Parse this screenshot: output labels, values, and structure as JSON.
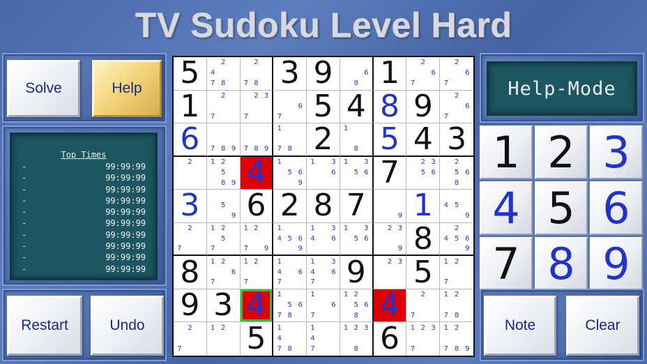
{
  "title": "TV Sudoku Level Hard",
  "buttons": {
    "solve": "Solve",
    "help": "Help",
    "restart": "Restart",
    "undo": "Undo",
    "note": "Note",
    "clear": "Clear"
  },
  "mode_display": "Help-Mode",
  "top_times": {
    "header": "Top Times",
    "rows": [
      {
        "name": "-",
        "time": "99:99:99"
      },
      {
        "name": "-",
        "time": "99:99:99"
      },
      {
        "name": "-",
        "time": "99:99:99"
      },
      {
        "name": "-",
        "time": "99:99:99"
      },
      {
        "name": "-",
        "time": "99:99:99"
      },
      {
        "name": "-",
        "time": "99:99:99"
      },
      {
        "name": "-",
        "time": "99:99:99"
      },
      {
        "name": "-",
        "time": "99:99:99"
      },
      {
        "name": "-",
        "time": "99:99:99"
      },
      {
        "name": "-",
        "time": "99:99:99"
      }
    ]
  },
  "keypad": [
    {
      "digit": "1",
      "state": "given"
    },
    {
      "digit": "2",
      "state": "given"
    },
    {
      "digit": "3",
      "state": "blue"
    },
    {
      "digit": "4",
      "state": "blue"
    },
    {
      "digit": "5",
      "state": "given"
    },
    {
      "digit": "6",
      "state": "blue"
    },
    {
      "digit": "7",
      "state": "given"
    },
    {
      "digit": "8",
      "state": "blue"
    },
    {
      "digit": "9",
      "state": "blue"
    }
  ],
  "colors": {
    "given": "#111111",
    "user": "#2233cc",
    "conflict": "#e00000",
    "selected": "#2bbf3a"
  },
  "board": [
    [
      {
        "v": "5"
      },
      {
        "n": "2,4,7,8"
      },
      {
        "n": "2,7,8"
      },
      {
        "v": "3"
      },
      {
        "v": "9"
      },
      {
        "n": "6,8"
      },
      {
        "v": "1"
      },
      {
        "n": "2,6,7"
      },
      {
        "n": "2,6,7"
      }
    ],
    [
      {
        "v": "1"
      },
      {
        "n": "2,7"
      },
      {
        "n": "2,3,7"
      },
      {
        "n": "6,7"
      },
      {
        "v": "5"
      },
      {
        "v": "4"
      },
      {
        "v": "8",
        "c": "blue"
      },
      {
        "v": "9"
      },
      {
        "n": "2,6,7"
      }
    ],
    [
      {
        "v": "6",
        "c": "blue"
      },
      {
        "n": "7,8,9"
      },
      {
        "n": "7,8,9"
      },
      {
        "n": "1,7,8"
      },
      {
        "v": "2"
      },
      {
        "n": "1,8"
      },
      {
        "v": "5",
        "c": "blue"
      },
      {
        "v": "4"
      },
      {
        "v": "3"
      }
    ],
    [
      {
        "n": "2"
      },
      {
        "n": "1,2,5,8,9"
      },
      {
        "v": "4",
        "c": "conflict"
      },
      {
        "n": "1,5,6,9"
      },
      {
        "n": "1,3,6"
      },
      {
        "n": "1,3,5,6"
      },
      {
        "v": "7"
      },
      {
        "n": "2,3,5,6"
      },
      {
        "n": "2,5,6,8"
      }
    ],
    [
      {
        "v": "3",
        "c": "blue"
      },
      {
        "n": "5,9"
      },
      {
        "v": "6"
      },
      {
        "v": "2"
      },
      {
        "v": "8"
      },
      {
        "v": "7"
      },
      {
        "n": "9"
      },
      {
        "v": "1",
        "c": "blue"
      },
      {
        "n": "4,5,9"
      }
    ],
    [
      {
        "n": "2,7"
      },
      {
        "n": "1,2,5,7"
      },
      {
        "n": "1,2,7,9"
      },
      {
        "n": "1,4,5,6,9"
      },
      {
        "n": "1,3,4,6"
      },
      {
        "n": "1,3,5,6"
      },
      {
        "n": "2,3,9"
      },
      {
        "v": "8"
      },
      {
        "n": "2,4,5,6,9"
      }
    ],
    [
      {
        "v": "8"
      },
      {
        "n": "1,2,6,7"
      },
      {
        "n": "1,2,7"
      },
      {
        "n": "1,4,6,7"
      },
      {
        "n": "1,3,4,6,7"
      },
      {
        "v": "9"
      },
      {
        "n": "2,3"
      },
      {
        "v": "5"
      },
      {
        "n": "1,2,7"
      }
    ],
    [
      {
        "v": "9"
      },
      {
        "v": "3"
      },
      {
        "v": "4",
        "c": "conflict",
        "sel": true
      },
      {
        "n": "1,5,6,7,8"
      },
      {
        "n": "1,6,7"
      },
      {
        "n": "1,2,5,6,8"
      },
      {
        "v": "4",
        "c": "conflict"
      },
      {
        "n": "2,7"
      },
      {
        "n": "1,2,7,8"
      }
    ],
    [
      {
        "n": "2,7"
      },
      {
        "n": "1,2"
      },
      {
        "v": "5"
      },
      {
        "n": "1,4,7,8"
      },
      {
        "n": "1,4,7"
      },
      {
        "n": "1,2,3,8"
      },
      {
        "v": "6"
      },
      {
        "n": "2,3,1,7"
      },
      {
        "n": "1,2,7,8,9"
      }
    ]
  ]
}
